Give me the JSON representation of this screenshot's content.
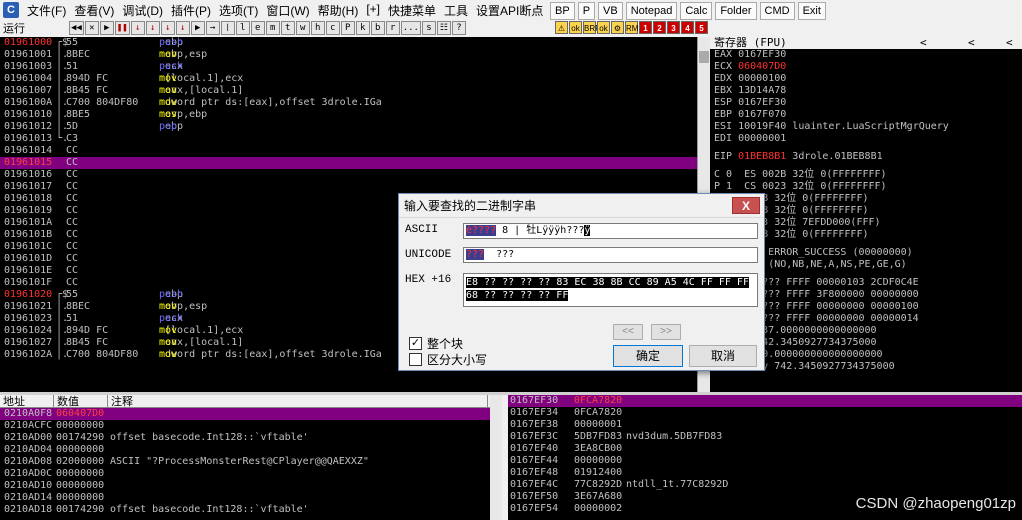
{
  "menu": {
    "app_icon": "C",
    "items": [
      "文件(F)",
      "查看(V)",
      "调试(D)",
      "插件(P)",
      "选项(T)",
      "窗口(W)",
      "帮助(H)",
      "[+]",
      "快捷菜单",
      "工具",
      "设置API断点"
    ]
  },
  "toolbar": {
    "status": "运行",
    "buttons": [
      "◀◀",
      "✕",
      "▶",
      "❚❚",
      "↓",
      "↓",
      "↓",
      "↓",
      "▶",
      "→",
      "❘",
      "l",
      "e",
      "m",
      "t",
      "w",
      "h",
      "c",
      "P",
      "k",
      "b",
      "r",
      "...",
      "s",
      "☷",
      "?"
    ],
    "plugin_buttons": [
      "BP",
      "P",
      "VB",
      "Notepad",
      "Calc",
      "Folder",
      "CMD",
      "Exit"
    ],
    "quick_icons": [
      "⚠",
      "ok",
      "BRP",
      "ok",
      "⚙",
      "RM",
      "1",
      "2",
      "3",
      "4",
      "5"
    ]
  },
  "disasm": [
    {
      "addr": "01961000",
      "mark": "┌$",
      "hex": "55",
      "op": "push",
      "args": "ebp",
      "sel": false,
      "red": true
    },
    {
      "addr": "01961001",
      "mark": "│.",
      "hex": "8BEC",
      "op": "mov",
      "args": "ebp,esp"
    },
    {
      "addr": "01961003",
      "mark": "│.",
      "hex": "51",
      "op": "push",
      "args": "ecx"
    },
    {
      "addr": "01961004",
      "mark": "│.",
      "hex": "894D FC",
      "op": "mov",
      "args": "[local.1],ecx"
    },
    {
      "addr": "01961007",
      "mark": "│.",
      "hex": "8B45 FC",
      "op": "mov",
      "args": "eax,[local.1]"
    },
    {
      "addr": "0196100A",
      "mark": "│.",
      "hex": "C700 804DF80",
      "op": "mov",
      "args": "dword ptr ds:[eax],offset 3drole.IGa"
    },
    {
      "addr": "01961010",
      "mark": "│.",
      "hex": "8BE5",
      "op": "mov",
      "args": "esp,ebp"
    },
    {
      "addr": "01961012",
      "mark": "│.",
      "hex": "5D",
      "op": "pop",
      "args": "ebp"
    },
    {
      "addr": "01961013",
      "mark": "└.",
      "hex": "C3",
      "op": "retn",
      "args": ""
    },
    {
      "addr": "01961014",
      "mark": "",
      "hex": "CC",
      "op": "int3",
      "args": ""
    },
    {
      "addr": "01961015",
      "mark": "",
      "hex": "CC",
      "op": "int3",
      "args": "",
      "sel": true
    },
    {
      "addr": "01961016",
      "mark": "",
      "hex": "CC",
      "op": "int3",
      "args": ""
    },
    {
      "addr": "01961017",
      "mark": "",
      "hex": "CC",
      "op": "int3",
      "args": ""
    },
    {
      "addr": "01961018",
      "mark": "",
      "hex": "CC",
      "op": "int3",
      "args": ""
    },
    {
      "addr": "01961019",
      "mark": "",
      "hex": "CC",
      "op": "int3",
      "args": ""
    },
    {
      "addr": "0196101A",
      "mark": "",
      "hex": "CC",
      "op": "int3",
      "args": ""
    },
    {
      "addr": "0196101B",
      "mark": "",
      "hex": "CC",
      "op": "int3",
      "args": ""
    },
    {
      "addr": "0196101C",
      "mark": "",
      "hex": "CC",
      "op": "int3",
      "args": ""
    },
    {
      "addr": "0196101D",
      "mark": "",
      "hex": "CC",
      "op": "int3",
      "args": ""
    },
    {
      "addr": "0196101E",
      "mark": "",
      "hex": "CC",
      "op": "int3",
      "args": ""
    },
    {
      "addr": "0196101F",
      "mark": "",
      "hex": "CC",
      "op": "int3",
      "args": ""
    },
    {
      "addr": "01961020",
      "mark": "┌$",
      "hex": "55",
      "op": "push",
      "args": "ebp",
      "red": true
    },
    {
      "addr": "01961021",
      "mark": "│.",
      "hex": "8BEC",
      "op": "mov",
      "args": "ebp,esp"
    },
    {
      "addr": "01961023",
      "mark": "│.",
      "hex": "51",
      "op": "push",
      "args": "ecx"
    },
    {
      "addr": "01961024",
      "mark": "│.",
      "hex": "894D FC",
      "op": "mov",
      "args": "[local.1],ecx"
    },
    {
      "addr": "01961027",
      "mark": "│.",
      "hex": "8B45 FC",
      "op": "mov",
      "args": "eax,[local.1]"
    },
    {
      "addr": "0196102A",
      "mark": "│.",
      "hex": "C700 804DF80",
      "op": "mov",
      "args": "dword ptr ds:[eax],offset 3drole.IGa"
    }
  ],
  "registers": {
    "title": "寄存器 (FPU)",
    "arrows": [
      "<",
      "<",
      "<"
    ],
    "lines": [
      {
        "name": "EAX",
        "val": "0167EF30",
        "note": "",
        "red": false
      },
      {
        "name": "ECX",
        "val": "060407D0",
        "note": "",
        "red": true
      },
      {
        "name": "EDX",
        "val": "00000100",
        "note": ""
      },
      {
        "name": "EBX",
        "val": "13D14A78",
        "note": ""
      },
      {
        "name": "ESP",
        "val": "0167EF30",
        "note": ""
      },
      {
        "name": "EBP",
        "val": "0167F070",
        "note": ""
      },
      {
        "name": "ESI",
        "val": "10019F40",
        "note": "luainter.LuaScriptMgrQuery"
      },
      {
        "name": "EDI",
        "val": "00000001",
        "note": ""
      }
    ],
    "eip": {
      "name": "EIP",
      "val": "01BEB8B1",
      "note": "3drole.01BEB8B1"
    },
    "flags": [
      "C 0  ES 002B 32位 0(FFFFFFFF)",
      "P 1  CS 0023 32位 0(FFFFFFFF)",
      "     002B 32位 0(FFFFFFFF)",
      "     002B 32位 0(FFFFFFFF)",
      "     0053 32位 7EFDD000(FFF)",
      "     002B 32位 0(FFFFFFFF)"
    ],
    "lasterr": "   stErr ERROR_SUCCESS (00000000)",
    "efl": {
      "val": "00206",
      "note": "(NO,NB,NE,A,NS,PE,GE,G)"
    },
    "fpu": [
      "     y -??? FFFF 00000103 2CDF0C4E",
      "     y -??? FFFF 3F800000 00000000",
      "     y -??? FFFF 00000000 00000100",
      "     y -??? FFFF 00000000 00000014",
      "     y 537.0000000000000000",
      "     y 742.3450927734375000",
      "     y 40.000000000000000000",
      "ST7 empty 742.3450927734375000"
    ]
  },
  "dump": {
    "headers": [
      "地址",
      "数值",
      "注释"
    ],
    "rows": [
      {
        "addr": "0210A0F8",
        "val": "060407D0",
        "note": "",
        "sel": true
      },
      {
        "addr": "0210ACFC",
        "val": "00000000",
        "note": ""
      },
      {
        "addr": "0210AD00",
        "val": "00174290",
        "note": "offset basecode.Int128::`vftable'"
      },
      {
        "addr": "0210AD04",
        "val": "00000000",
        "note": ""
      },
      {
        "addr": "0210AD08",
        "val": "02000000",
        "note": "ASCII \"?ProcessMonsterRest@CPlayer@@QAEXXZ\""
      },
      {
        "addr": "0210AD0C",
        "val": "00000000",
        "note": ""
      },
      {
        "addr": "0210AD10",
        "val": "00000000",
        "note": ""
      },
      {
        "addr": "0210AD14",
        "val": "00000000",
        "note": ""
      },
      {
        "addr": "0210AD18",
        "val": "00174290",
        "note": "offset basecode.Int128::`vftable'"
      }
    ]
  },
  "stack": {
    "rows": [
      {
        "addr": "0167EF30",
        "val": "0FCA7820",
        "note": "",
        "sel": true
      },
      {
        "addr": "0167EF34",
        "val": "0FCA7820",
        "note": ""
      },
      {
        "addr": "0167EF38",
        "val": "00000001",
        "note": ""
      },
      {
        "addr": "0167EF3C",
        "val": "5DB7FD83",
        "note": "nvd3dum.5DB7FD83"
      },
      {
        "addr": "0167EF40",
        "val": "3EA8CB00",
        "note": ""
      },
      {
        "addr": "0167EF44",
        "val": "00000000",
        "note": ""
      },
      {
        "addr": "0167EF48",
        "val": "01912400",
        "note": ""
      },
      {
        "addr": "0167EF4C",
        "val": "77C8292D",
        "note": "ntdll_1t.77C8292D"
      },
      {
        "addr": "0167EF50",
        "val": "3E67A680",
        "note": ""
      },
      {
        "addr": "0167EF54",
        "val": "00000002",
        "note": ""
      }
    ]
  },
  "watermark": "CSDN @zhaopeng01zp",
  "dialog": {
    "title": "输入要查找的二进制字串",
    "close": "X",
    "ascii_label": "ASCII",
    "ascii_value_hl": "è????",
    "ascii_value_rest": " 8 | 牡Lÿÿÿh???",
    "ascii_value_tail": "ÿ",
    "unicode_label": "UNICODE",
    "unicode_value_hl": "???",
    "unicode_value_rest": "  ???",
    "hex_label": "HEX +16",
    "hex_line1_sel": "E8 ?? ?? ?? ??",
    "hex_line1_rest": " 83 EC 38 8B CC 89 A5 4C FF FF FF",
    "hex_line2_sel": "68 ?? ?? ?? ?? FF",
    "check_whole": "整个块",
    "check_whole_state": "✓",
    "check_case": "区分大小写",
    "prev": "<<",
    "next": ">>",
    "ok": "确定",
    "cancel": "取消"
  }
}
